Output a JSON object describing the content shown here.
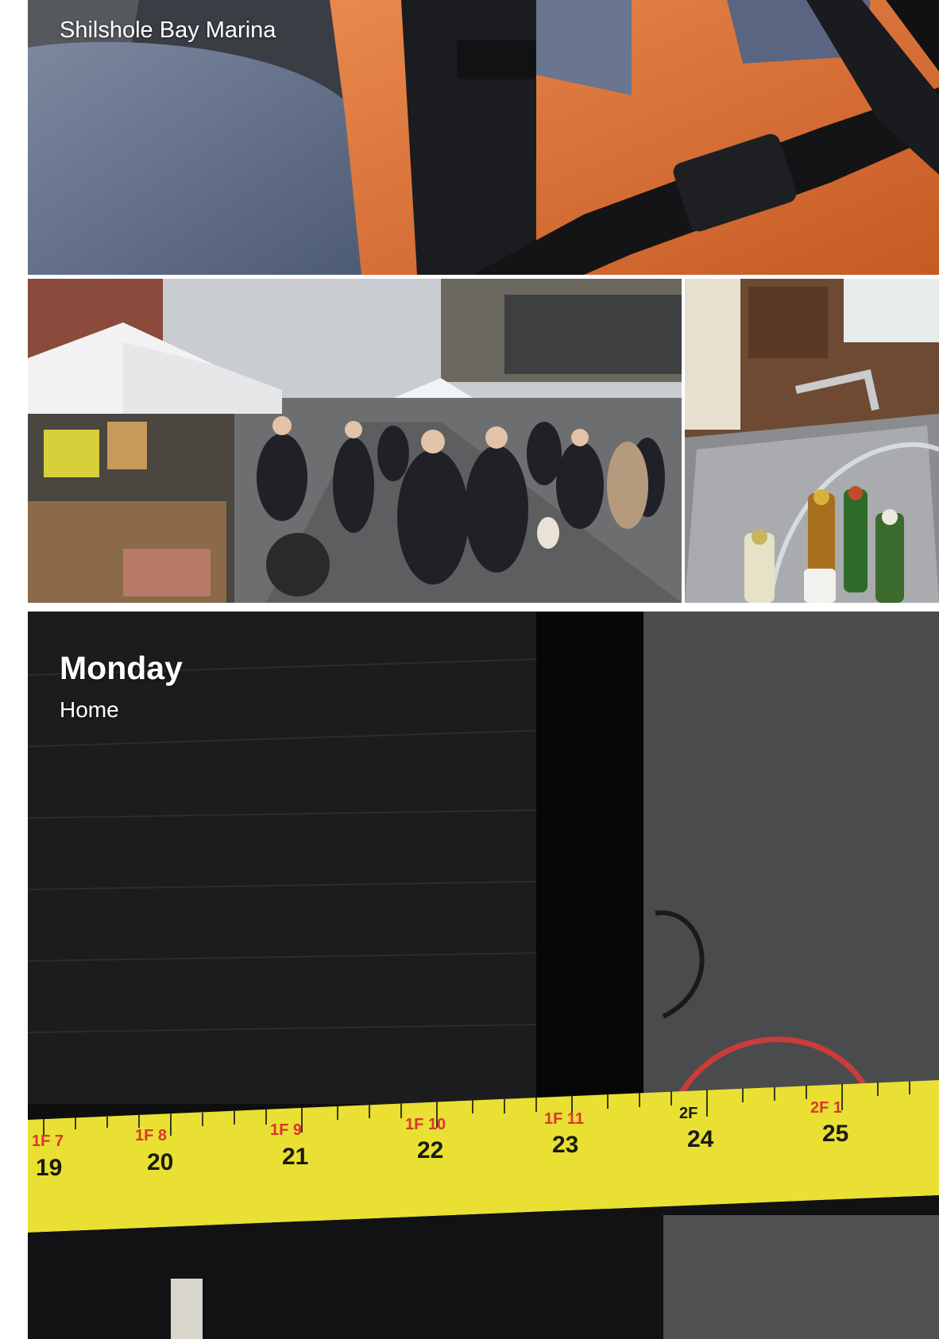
{
  "gallery": {
    "sections": [
      {
        "place": "Shilshole Bay Marina",
        "photos": [
          {
            "id": "orange-jacket-backpack",
            "description_icon": "photo-icon"
          }
        ]
      },
      {
        "photos": [
          {
            "id": "street-market-crowd"
          },
          {
            "id": "cooler-with-bottles"
          }
        ]
      },
      {
        "day": "Monday",
        "place": "Home",
        "photos": [
          {
            "id": "tape-measure-shelf"
          }
        ]
      }
    ]
  },
  "tape_measure": {
    "inch_labels": [
      "19",
      "20",
      "21",
      "22",
      "23",
      "24",
      "25"
    ],
    "foot_labels": [
      "1F 7",
      "1F 8",
      "1F 9",
      "1F 10",
      "1F 11",
      "2F",
      "2F 1"
    ]
  },
  "colors": {
    "background": "#ffffff",
    "tape_yellow": "#e9e033",
    "tape_red": "#d8372b",
    "jacket_orange": "#e0743a",
    "jacket_slate": "#6b7894"
  }
}
